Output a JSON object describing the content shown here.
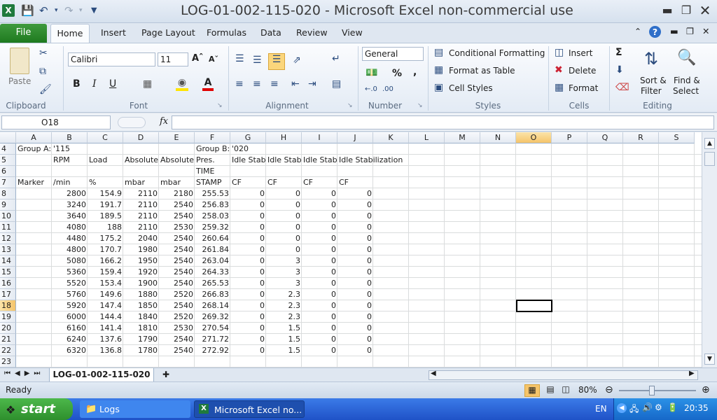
{
  "window": {
    "title": "LOG-01-002-115-020  -  Microsoft Excel non-commercial use"
  },
  "tabs": [
    "File",
    "Home",
    "Insert",
    "Page Layout",
    "Formulas",
    "Data",
    "Review",
    "View"
  ],
  "ribbon": {
    "clipboard": {
      "paste": "Paste",
      "label": "Clipboard"
    },
    "font": {
      "name": "Calibri",
      "size": "11",
      "label": "Font"
    },
    "alignment": {
      "label": "Alignment"
    },
    "number": {
      "format": "General",
      "label": "Number"
    },
    "styles": {
      "conditional": "Conditional Formatting",
      "table": "Format as Table",
      "cell": "Cell Styles",
      "label": "Styles"
    },
    "cells": {
      "insert": "Insert",
      "delete": "Delete",
      "format": "Format",
      "label": "Cells"
    },
    "editing": {
      "sort1": "Sort &",
      "sort2": "Filter",
      "find1": "Find &",
      "find2": "Select",
      "label": "Editing"
    }
  },
  "formula_bar": {
    "name_box": "O18",
    "fx": "fx",
    "value": ""
  },
  "columns": [
    "A",
    "B",
    "C",
    "D",
    "E",
    "F",
    "G",
    "H",
    "I",
    "J",
    "K",
    "L",
    "M",
    "N",
    "O",
    "P",
    "Q",
    "R",
    "S"
  ],
  "selected_column": "O",
  "selected_row": "18",
  "rows": [
    {
      "n": "4",
      "cells": {
        "A": "Group A:",
        "B": "'115",
        "F": "Group B:",
        "G": "'020"
      }
    },
    {
      "n": "5",
      "cells": {
        "B": "RPM",
        "C": "Load",
        "D": "Absolute",
        "E": "Absolute",
        "F": "Pres.",
        "G": "Idle Stab",
        "H": "Idle Stab",
        "I": "Idle Stab",
        "J": "Idle Stabilization"
      }
    },
    {
      "n": "6",
      "cells": {
        "F": "TIME"
      }
    },
    {
      "n": "7",
      "cells": {
        "A": "Marker",
        "B": "/min",
        "C": "%",
        "D": "mbar",
        "E": "mbar",
        "F": "STAMP",
        "G": "CF",
        "H": "CF",
        "I": "CF",
        "J": "CF"
      }
    },
    {
      "n": "8",
      "cells": {
        "B": "2800",
        "C": "154.9",
        "D": "2110",
        "E": "2180",
        "F": "255.53",
        "G": "0",
        "H": "0",
        "I": "0",
        "J": "0"
      }
    },
    {
      "n": "9",
      "cells": {
        "B": "3240",
        "C": "191.7",
        "D": "2110",
        "E": "2540",
        "F": "256.83",
        "G": "0",
        "H": "0",
        "I": "0",
        "J": "0"
      }
    },
    {
      "n": "10",
      "cells": {
        "B": "3640",
        "C": "189.5",
        "D": "2110",
        "E": "2540",
        "F": "258.03",
        "G": "0",
        "H": "0",
        "I": "0",
        "J": "0"
      }
    },
    {
      "n": "11",
      "cells": {
        "B": "4080",
        "C": "188",
        "D": "2110",
        "E": "2530",
        "F": "259.32",
        "G": "0",
        "H": "0",
        "I": "0",
        "J": "0"
      }
    },
    {
      "n": "12",
      "cells": {
        "B": "4480",
        "C": "175.2",
        "D": "2040",
        "E": "2540",
        "F": "260.64",
        "G": "0",
        "H": "0",
        "I": "0",
        "J": "0"
      }
    },
    {
      "n": "13",
      "cells": {
        "B": "4800",
        "C": "170.7",
        "D": "1980",
        "E": "2540",
        "F": "261.84",
        "G": "0",
        "H": "0",
        "I": "0",
        "J": "0"
      }
    },
    {
      "n": "14",
      "cells": {
        "B": "5080",
        "C": "166.2",
        "D": "1950",
        "E": "2540",
        "F": "263.04",
        "G": "0",
        "H": "3",
        "I": "0",
        "J": "0"
      }
    },
    {
      "n": "15",
      "cells": {
        "B": "5360",
        "C": "159.4",
        "D": "1920",
        "E": "2540",
        "F": "264.33",
        "G": "0",
        "H": "3",
        "I": "0",
        "J": "0"
      }
    },
    {
      "n": "16",
      "cells": {
        "B": "5520",
        "C": "153.4",
        "D": "1900",
        "E": "2540",
        "F": "265.53",
        "G": "0",
        "H": "3",
        "I": "0",
        "J": "0"
      }
    },
    {
      "n": "17",
      "cells": {
        "B": "5760",
        "C": "149.6",
        "D": "1880",
        "E": "2520",
        "F": "266.83",
        "G": "0",
        "H": "2.3",
        "I": "0",
        "J": "0"
      }
    },
    {
      "n": "18",
      "cells": {
        "B": "5920",
        "C": "147.4",
        "D": "1850",
        "E": "2540",
        "F": "268.14",
        "G": "0",
        "H": "2.3",
        "I": "0",
        "J": "0"
      }
    },
    {
      "n": "19",
      "cells": {
        "B": "6000",
        "C": "144.4",
        "D": "1840",
        "E": "2520",
        "F": "269.32",
        "G": "0",
        "H": "2.3",
        "I": "0",
        "J": "0"
      }
    },
    {
      "n": "20",
      "cells": {
        "B": "6160",
        "C": "141.4",
        "D": "1810",
        "E": "2530",
        "F": "270.54",
        "G": "0",
        "H": "1.5",
        "I": "0",
        "J": "0"
      }
    },
    {
      "n": "21",
      "cells": {
        "B": "6240",
        "C": "137.6",
        "D": "1790",
        "E": "2540",
        "F": "271.72",
        "G": "0",
        "H": "1.5",
        "I": "0",
        "J": "0"
      }
    },
    {
      "n": "22",
      "cells": {
        "B": "6320",
        "C": "136.8",
        "D": "1780",
        "E": "2540",
        "F": "272.92",
        "G": "0",
        "H": "1.5",
        "I": "0",
        "J": "0"
      }
    },
    {
      "n": "23",
      "cells": {}
    }
  ],
  "sheet": {
    "name": "LOG-01-002-115-020"
  },
  "status": {
    "ready": "Ready",
    "zoom": "80%"
  },
  "taskbar": {
    "start": "start",
    "logs": "Logs",
    "excel": "Microsoft Excel no...",
    "lang": "EN",
    "clock": "20:35"
  },
  "colors": {
    "accent": "#217346",
    "selection": "#f5c46a"
  }
}
